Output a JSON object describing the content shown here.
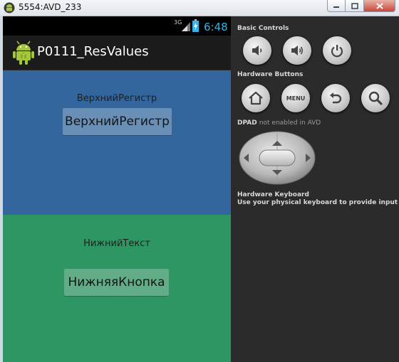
{
  "window": {
    "title": "5554:AVD_233"
  },
  "status_bar": {
    "network": "3G",
    "clock": "6:48"
  },
  "app": {
    "title": "P0111_ResValues"
  },
  "top_panel": {
    "label": "ВерхнийРегистр",
    "button": "ВерхнийРегистр",
    "color": "#32669d"
  },
  "bottom_panel": {
    "label": "НижнийТекст",
    "button": "НижняяКнопка",
    "color": "#2e9663"
  },
  "controls": {
    "basic_controls": "Basic Controls",
    "hardware_buttons": "Hardware Buttons",
    "menu_label": "MENU",
    "dpad_title": "DPAD",
    "dpad_note": "not enabled in AVD",
    "keyboard_title": "Hardware Keyboard",
    "keyboard_note": "Use your physical keyboard to provide input"
  }
}
